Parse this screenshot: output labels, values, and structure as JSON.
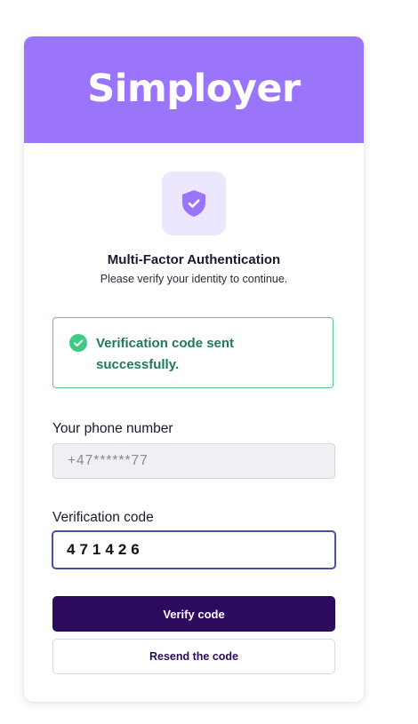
{
  "brand": {
    "name": "Simployer",
    "header_color": "#9b74fc"
  },
  "mfa": {
    "icon": "shield-check-icon",
    "title": "Multi-Factor Authentication",
    "subtitle": "Please verify your identity to continue."
  },
  "alert": {
    "icon": "check-circle-icon",
    "message": "Verification code sent successfully.",
    "color": "#1f7a55"
  },
  "phone": {
    "label": "Your phone number",
    "value": "+47******77"
  },
  "code": {
    "label": "Verification code",
    "value": "471426"
  },
  "actions": {
    "verify_label": "Verify code",
    "resend_label": "Resend the code",
    "primary_color": "#2c0b5f"
  }
}
